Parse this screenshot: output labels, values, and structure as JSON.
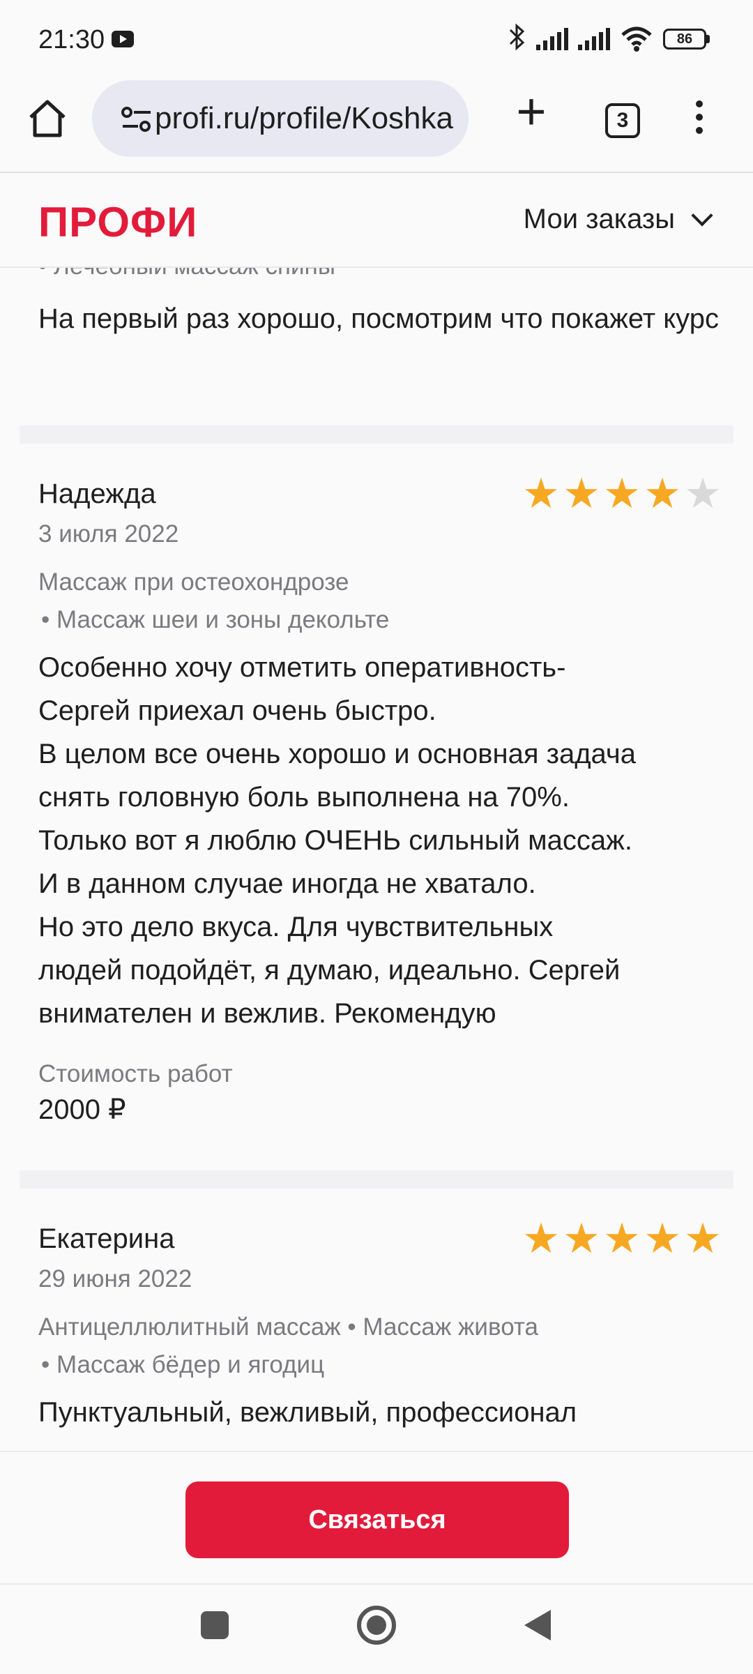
{
  "status_bar": {
    "time": "21:30",
    "battery": "86",
    "icons": [
      "youtube-icon",
      "bluetooth-icon",
      "signal-icon",
      "signal-icon",
      "wifi-icon",
      "battery-icon"
    ]
  },
  "browser": {
    "url": "profi.ru/profile/Koshkarov",
    "tab_count": "3",
    "icons": [
      "home-icon",
      "site-settings-icon",
      "new-tab-icon",
      "tabs-icon",
      "more-menu-icon"
    ]
  },
  "header": {
    "logo": "ПРОФИ",
    "orders_label": "Мои заказы"
  },
  "previous_review": {
    "category_cut": "• Лечебный массаж спины",
    "text": "На первый раз хорошо, посмотрим что покажет курс"
  },
  "reviews": [
    {
      "name": "Надежда",
      "rating": 4,
      "date": "3 июля 2022",
      "categories_line1": "Массаж при остеохондрозе",
      "categories_line2": "• Массаж шеи и зоны декольте",
      "text_lines": [
        "Особенно хочу отметить оперативность-",
        "Сергей приехал очень быстро.",
        "В целом все очень хорошо и основная задача",
        "снять головную боль выполнена на 70%.",
        "Только вот я люблю ОЧЕНЬ сильный массаж.",
        "И в данном случае иногда не хватало.",
        "Но это дело вкуса. Для чувствительных",
        "людей подойдёт, я думаю, идеально. Сергей",
        "внимателен и вежлив. Рекомендую"
      ],
      "cost_label": "Стоимость работ",
      "cost": "2000 ₽"
    },
    {
      "name": "Екатерина",
      "rating": 5,
      "date": "29 июня 2022",
      "categories_line1": "Антицеллюлитный массаж • Массаж живота",
      "categories_line2": "• Массаж бёдер и ягодиц",
      "text_lines": [
        "Пунктуальный, вежливый, профессионал"
      ]
    }
  ],
  "cta": {
    "label": "Связаться",
    "color": "#e31b3b"
  },
  "nav": {
    "icons": [
      "recents-icon",
      "home-circle-icon",
      "back-icon"
    ]
  },
  "colors": {
    "accent": "#e31b3b",
    "star": "#f7a823",
    "star_empty": "#d9d9d9",
    "muted": "#7a7a80"
  }
}
